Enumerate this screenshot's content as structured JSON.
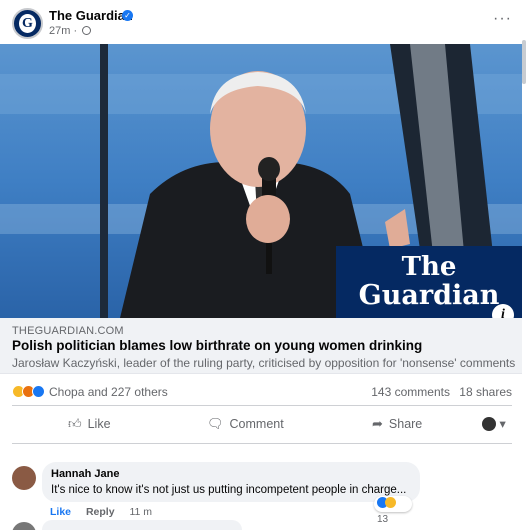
{
  "header": {
    "page_name": "The Guardian",
    "time": "27m",
    "avatar_letter": "G",
    "more_label": "···"
  },
  "photo": {
    "logo_line1": "The",
    "logo_line2": "Guardian",
    "info_label": "i"
  },
  "link": {
    "domain": "THEGUARDIAN.COM",
    "headline": "Polish politician blames low birthrate on young women drinking",
    "subline": "Jarosław Kaczyński, leader of the ruling party, criticised by opposition for 'nonsense' comments"
  },
  "stats": {
    "likers": "Chopa and 227 others",
    "comments": "143 comments",
    "shares": "18 shares"
  },
  "actions": {
    "like": "Like",
    "comment": "Comment",
    "share": "Share"
  },
  "comment": {
    "author": "Hannah Jane",
    "text": "It's nice to know it's not just us putting incompetent people in charge...",
    "reaction_count": "13",
    "like": "Like",
    "reply": "Reply",
    "time": "11 m"
  },
  "colors": {
    "brand": "#1877f2",
    "guardian_navy": "#052962"
  },
  "icons": [
    "verified-icon",
    "globe-icon",
    "more-icon",
    "info-icon",
    "haha-icon",
    "angry-icon",
    "like-reaction-icon",
    "thumbs-up-icon",
    "comment-icon",
    "share-icon",
    "audience-icon"
  ]
}
